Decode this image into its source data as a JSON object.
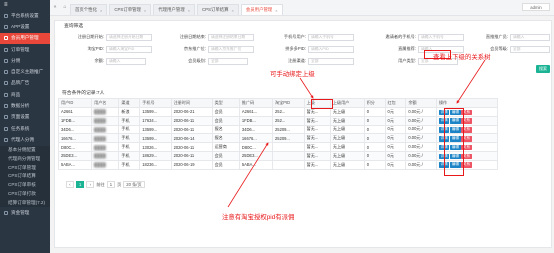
{
  "sidebar": {
    "logo": "",
    "items": [
      {
        "label": "平台系统设置",
        "icon": "gear-icon"
      },
      {
        "label": "APP设置",
        "icon": "phone-icon"
      },
      {
        "label": "会员用户管理",
        "icon": "users-icon",
        "active": true
      },
      {
        "label": "订单管理",
        "icon": "order-icon"
      },
      {
        "label": "分佣",
        "icon": "money-icon"
      },
      {
        "label": "自定义主题推广",
        "icon": "theme-icon"
      },
      {
        "label": "品牌广告",
        "icon": "ad-icon"
      },
      {
        "label": "商品",
        "icon": "goods-icon"
      },
      {
        "label": "数据分析",
        "icon": "chart-icon"
      },
      {
        "label": "页面设置",
        "icon": "page-icon"
      },
      {
        "label": "任务系统",
        "icon": "task-icon"
      },
      {
        "label": "代理人分佣",
        "icon": "agent-icon"
      }
    ],
    "subitems": [
      "基本分佣配置",
      "代理商分佣管理",
      "CPS订单管理",
      "CPS订单结算",
      "CPS订单审核",
      "CPS订单打款",
      "结算订单管理(7.2)"
    ],
    "bottom": "资金管理"
  },
  "tabs": {
    "items": [
      "首页个性化",
      "CPS订单管理",
      "代理用户管理",
      "CPS订单结算",
      "会员用户管理"
    ],
    "active_index": 4
  },
  "user": {
    "name": "admin"
  },
  "filter": {
    "section_title": "查询筛选",
    "fields": [
      {
        "label": "注册日期开始:",
        "placeholder": "请选择注册开始日期"
      },
      {
        "label": "注册日期结束:",
        "placeholder": "请选择注册结束日期"
      },
      {
        "label": "手机号用户:",
        "placeholder": "请输入手机号"
      },
      {
        "label": "邀请者的手机号:",
        "placeholder": "请输入手机号"
      },
      {
        "label": "直推推广员:",
        "placeholder": "请输入"
      },
      {
        "label": "淘宝PID:",
        "placeholder": "请输入淘宝PID"
      },
      {
        "label": "京东推广位:",
        "placeholder": "请输入京东推广位"
      },
      {
        "label": "拼多多PID:",
        "placeholder": "请输入PID"
      },
      {
        "label": "直属推荐:",
        "placeholder": "请输入"
      },
      {
        "label": "会员等级:",
        "placeholder": "全部"
      },
      {
        "label": "余额:",
        "placeholder": "请输入"
      },
      {
        "label": "会员级别:",
        "placeholder": "全部"
      },
      {
        "label": "注册渠道:",
        "placeholder": "全部"
      },
      {
        "label": "用户类型:",
        "placeholder": "全部"
      }
    ],
    "search_label": "搜索"
  },
  "table": {
    "caption": "符合条件的记录:7人",
    "headers": [
      "用户ID",
      "用户名",
      "渠道",
      "手机号",
      "注册时间",
      "类型",
      "推广码",
      "淘宝PID",
      "上级",
      "上级用户",
      "积分",
      "红包",
      "余额",
      "操作"
    ],
    "rows": [
      [
        "A2661",
        "",
        "新浪",
        "13599...",
        "2020-06-21",
        "会员",
        "A2661...",
        "252...",
        "暂无...",
        "无上级",
        "0",
        "0元",
        "0.00元 /"
      ],
      [
        "1FDB...",
        "",
        "手机",
        "17634...",
        "2020-06-11",
        "会员",
        "1FDB...",
        "252...",
        "暂无...",
        "无上级",
        "0",
        "0元",
        "0.00元 /"
      ],
      [
        "34D6...",
        "",
        "手机",
        "13599...",
        "2020-06-11",
        "报名",
        "34D6...",
        "25209...",
        "暂无...",
        "无上级",
        "0",
        "0元",
        "0.00元 /"
      ],
      [
        "16676...",
        "",
        "手机",
        "13599...",
        "2020-06-14",
        "报名",
        "16676...",
        "25209...",
        "暂无...",
        "无上级",
        "0",
        "0元",
        "0.00元 /"
      ],
      [
        "D80C...",
        "",
        "手机",
        "13026...",
        "2020-06-11",
        "运营商",
        "D80C...",
        "",
        "暂无...",
        "无上级",
        "0",
        "0元",
        "0.00元 /"
      ],
      [
        "25DE3...",
        "",
        "手机",
        "18629...",
        "2020-06-11",
        "会员",
        "25DE3...",
        "",
        "暂无...",
        "无上级",
        "0",
        "0元",
        "0.00元 /"
      ],
      [
        "5ABA...",
        "",
        "手机",
        "18236...",
        "2020-06-19",
        "会员",
        "5ABA...",
        "",
        "暂无...",
        "无上级",
        "0",
        "0元",
        "0.00元 /"
      ]
    ],
    "op_labels": [
      "详情",
      "编辑",
      "关系"
    ]
  },
  "pagination": {
    "current": "1",
    "page_label": "前往",
    "page_value": "1",
    "total_label": "页",
    "size_label": "20 条/页"
  },
  "annotations": {
    "top_right": "查看上下级的关系树",
    "middle": "可手动绑定上级",
    "bottom": "注意有淘宝授权pid有派佣"
  },
  "colors": {
    "accent": "#e8473a",
    "annotation": "#e8191b",
    "sidebar": "#2b3643",
    "primary": "#1ab394"
  }
}
